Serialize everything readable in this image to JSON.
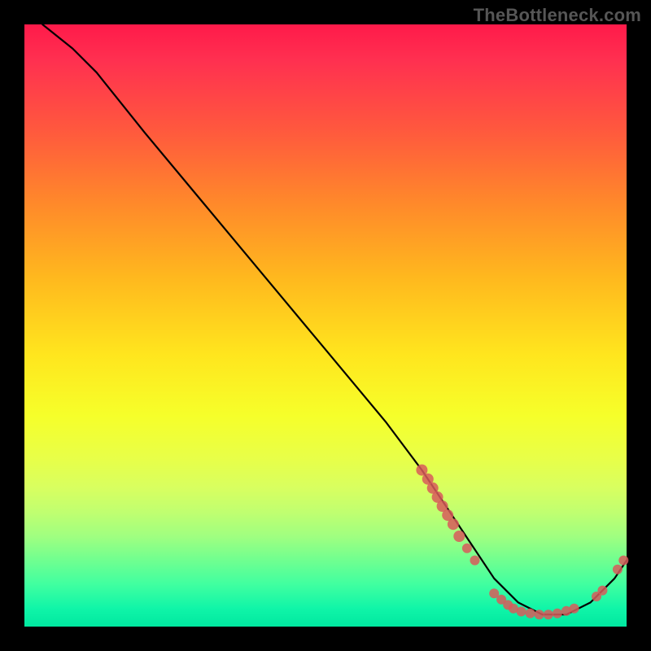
{
  "watermark": "TheBottleneck.com",
  "chart_data": {
    "type": "line",
    "title": "",
    "xlabel": "",
    "ylabel": "",
    "xlim": [
      0,
      100
    ],
    "ylim": [
      0,
      100
    ],
    "series": [
      {
        "name": "curve",
        "x": [
          3,
          8,
          12,
          20,
          30,
          40,
          50,
          60,
          66,
          70,
          74,
          78,
          82,
          86,
          90,
          94,
          98,
          100
        ],
        "y": [
          100,
          96,
          92,
          82,
          70,
          58,
          46,
          34,
          26,
          20,
          14,
          8,
          4,
          2,
          2,
          4,
          8,
          11
        ]
      }
    ],
    "points": [
      {
        "x": 66.0,
        "y": 26.0
      },
      {
        "x": 67.0,
        "y": 24.5
      },
      {
        "x": 67.8,
        "y": 23.0
      },
      {
        "x": 68.6,
        "y": 21.5
      },
      {
        "x": 69.4,
        "y": 20.0
      },
      {
        "x": 70.3,
        "y": 18.5
      },
      {
        "x": 71.2,
        "y": 17.0
      },
      {
        "x": 72.2,
        "y": 15.0
      },
      {
        "x": 73.5,
        "y": 13.0
      },
      {
        "x": 74.8,
        "y": 11.0
      },
      {
        "x": 78.0,
        "y": 5.5
      },
      {
        "x": 79.2,
        "y": 4.5
      },
      {
        "x": 80.3,
        "y": 3.6
      },
      {
        "x": 81.2,
        "y": 3.0
      },
      {
        "x": 82.5,
        "y": 2.5
      },
      {
        "x": 84.0,
        "y": 2.2
      },
      {
        "x": 85.5,
        "y": 2.0
      },
      {
        "x": 87.0,
        "y": 2.0
      },
      {
        "x": 88.5,
        "y": 2.2
      },
      {
        "x": 90.0,
        "y": 2.6
      },
      {
        "x": 91.3,
        "y": 3.0
      },
      {
        "x": 95.0,
        "y": 5.0
      },
      {
        "x": 96.0,
        "y": 6.0
      },
      {
        "x": 98.5,
        "y": 9.5
      },
      {
        "x": 99.5,
        "y": 11.0
      }
    ],
    "point_radius_default": 6,
    "point_radius_overrides": {
      "0": 7,
      "1": 7,
      "2": 7,
      "3": 7,
      "4": 7,
      "5": 7,
      "6": 7,
      "7": 7,
      "8": 6,
      "9": 6
    }
  }
}
